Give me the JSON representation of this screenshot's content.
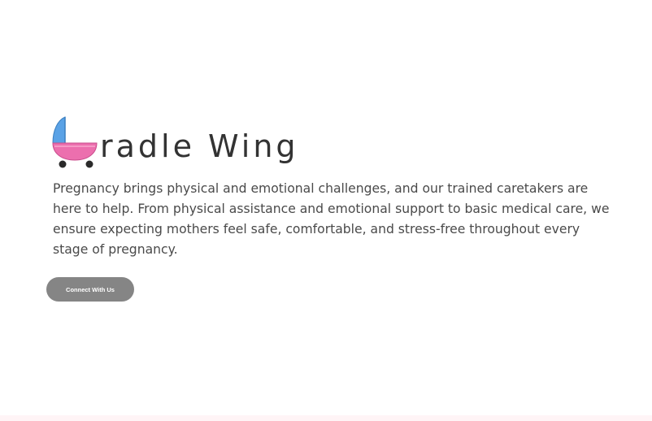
{
  "brand": {
    "name_rest": "radle Wing",
    "logo_icon": "baby-stroller-c",
    "colors": {
      "hood": "#5aa2e6",
      "basket": "#ec6fae",
      "wheels": "#2a2a2a"
    }
  },
  "hero": {
    "description": "Pregnancy brings physical and emotional challenges, and our trained caretakers are here to help. From physical assistance and emotional support to basic medical care, we ensure expecting mothers feel safe, comfortable, and stress-free throughout every stage of pregnancy.",
    "cta_label": "Connect With Us"
  },
  "colors": {
    "text": "#4a4a4a",
    "button": "#858585",
    "footer_strip": "#fff4f6"
  }
}
